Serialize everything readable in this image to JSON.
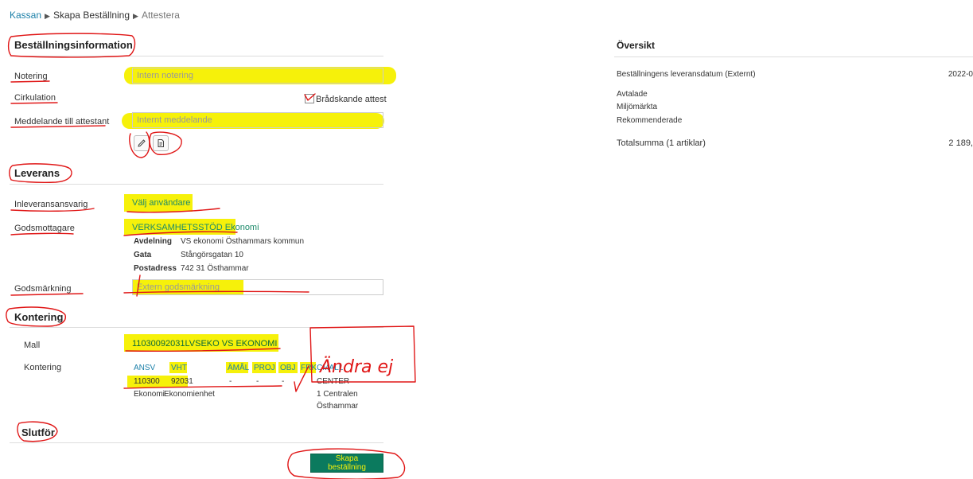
{
  "breadcrumb": {
    "items": [
      "Kassan",
      "Skapa Beställning",
      "Attestera"
    ]
  },
  "order_info": {
    "title": "Beställningsinformation",
    "note_label": "Notering",
    "note_placeholder": "Intern notering",
    "circulation_label": "Cirkulation",
    "urgent_label": "Brådskande attest",
    "message_label": "Meddelande till attestant",
    "message_placeholder": "Internt meddelande",
    "edit_icon": "pencil-icon",
    "template_icon": "document-icon"
  },
  "delivery": {
    "title": "Leverans",
    "receiver_label": "Inleveransansvarig",
    "receiver_value": "Välj användare",
    "goods_label": "Godsmottagare",
    "goods_value": "VERKSAMHETSSTÖD Ekonomi",
    "details": [
      {
        "key": "Avdelning",
        "value": "VS ekonomi Östhammars kommun"
      },
      {
        "key": "Gata",
        "value": "Stångörsgatan 10"
      },
      {
        "key": "Postadress",
        "value": "742 31 Östhammar"
      }
    ],
    "marking_label": "Godsmärkning",
    "marking_placeholder": "Extern godsmärkning"
  },
  "accounting": {
    "title": "Kontering",
    "template_label": "Mall",
    "template_value": "11030092031LVSEKO VS EKONOMI",
    "coding_label": "Kontering",
    "columns": [
      "ANSV",
      "VHT",
      "ÄMÅL",
      "PROJ",
      "OBJ",
      "FRK",
      "CMALL"
    ],
    "values": [
      "110300",
      "92031",
      "-",
      "-",
      "-",
      "",
      "CENTER"
    ],
    "descriptions": [
      "Ekonomi",
      "Ekonomienhet"
    ],
    "cmall_extra": [
      "1 Centralen",
      "Östhammar"
    ]
  },
  "finish": {
    "title": "Slutför",
    "submit_label": "Skapa beställning"
  },
  "overview": {
    "title": "Översikt",
    "delivery_date_label": "Beställningens leveransdatum (Externt)",
    "delivery_date_value": "2022-0",
    "agreed": "Avtalade",
    "eco": "Miljömärkta",
    "recommended": "Rekommenderade",
    "total_label": "Totalsumma (1 artiklar)",
    "total_value": "2 189,"
  },
  "annotation": {
    "handwritten_note": "Ändra ej"
  },
  "colors": {
    "link": "#1a7fa8",
    "primary_button": "#0b7a5e",
    "highlight": "#f6f10a",
    "annotation_ink": "#e01616"
  }
}
